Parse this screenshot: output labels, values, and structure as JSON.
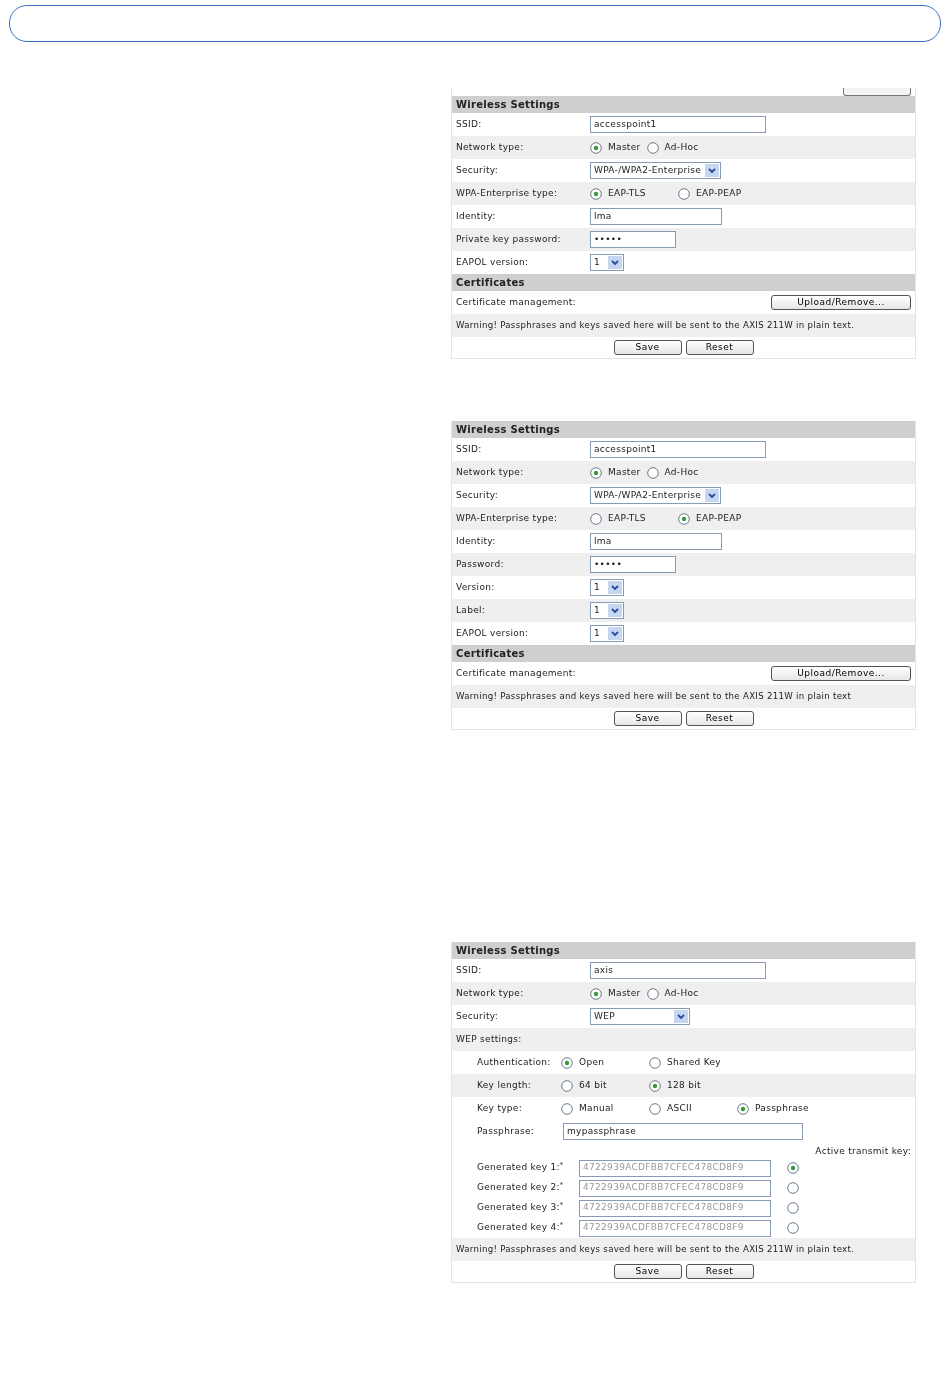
{
  "panels": [
    {
      "rows": [
        {
          "kind": "clipped_button"
        },
        {
          "kind": "section",
          "title": "Wireless Settings"
        },
        {
          "kind": "text",
          "label": "SSID:",
          "value": "accesspoint1"
        },
        {
          "kind": "radio",
          "label": "Network type:",
          "options": [
            {
              "label": "Master",
              "selected": true
            },
            {
              "label": "Ad-Hoc",
              "selected": false
            }
          ]
        },
        {
          "kind": "select",
          "label": "Security:",
          "value": "WPA-/WPA2-Enterprise"
        },
        {
          "kind": "radio_grid",
          "label": "WPA-Enterprise type:",
          "options": [
            {
              "label": "EAP-TLS",
              "selected": true
            },
            {
              "label": "EAP-PEAP",
              "selected": false
            }
          ]
        },
        {
          "kind": "short_text",
          "label": "Identity:",
          "value": "lma"
        },
        {
          "kind": "password",
          "label": "Private key password:",
          "value": "•••••"
        },
        {
          "kind": "short_select",
          "label": "EAPOL version:",
          "value": "1"
        },
        {
          "kind": "section",
          "title": "Certificates"
        },
        {
          "kind": "action",
          "label": "Certificate management:",
          "button": "Upload/Remove..."
        },
        {
          "kind": "note",
          "text": "Warning! Passphrases and keys saved here will be sent to the AXIS 211W in plain text."
        },
        {
          "kind": "buttons",
          "buttons": [
            "Save",
            "Reset"
          ]
        }
      ]
    },
    {
      "rows": [
        {
          "kind": "section",
          "title": "Wireless Settings"
        },
        {
          "kind": "text",
          "label": "SSID:",
          "value": "accesspoint1"
        },
        {
          "kind": "radio",
          "label": "Network type:",
          "options": [
            {
              "label": "Master",
              "selected": true
            },
            {
              "label": "Ad-Hoc",
              "selected": false
            }
          ]
        },
        {
          "kind": "select",
          "label": "Security:",
          "value": "WPA-/WPA2-Enterprise"
        },
        {
          "kind": "radio_grid",
          "label": "WPA-Enterprise type:",
          "options": [
            {
              "label": "EAP-TLS",
              "selected": false
            },
            {
              "label": "EAP-PEAP",
              "selected": true
            }
          ]
        },
        {
          "kind": "short_text",
          "label": "Identity:",
          "value": "lma"
        },
        {
          "kind": "password",
          "label": "Password:",
          "value": "•••••"
        },
        {
          "kind": "short_select",
          "label": "Version:",
          "value": "1"
        },
        {
          "kind": "short_select",
          "label": "Label:",
          "value": "1"
        },
        {
          "kind": "short_select",
          "label": "EAPOL version:",
          "value": "1"
        },
        {
          "kind": "section",
          "title": "Certificates"
        },
        {
          "kind": "action",
          "label": "Certificate management:",
          "button": "Upload/Remove..."
        },
        {
          "kind": "note",
          "text": "Warning! Passphrases and keys saved here will be sent to the AXIS 211W in plain text"
        },
        {
          "kind": "buttons",
          "buttons": [
            "Save",
            "Reset"
          ]
        }
      ]
    },
    {
      "rows": [
        {
          "kind": "section",
          "title": "Wireless Settings"
        },
        {
          "kind": "text",
          "label": "SSID:",
          "value": "axis"
        },
        {
          "kind": "radio",
          "label": "Network type:",
          "options": [
            {
              "label": "Master",
              "selected": true
            },
            {
              "label": "Ad-Hoc",
              "selected": false
            }
          ]
        },
        {
          "kind": "select",
          "label": "Security:",
          "value": "WEP"
        },
        {
          "kind": "group",
          "label": "WEP settings:",
          "children": [
            {
              "kind": "radio_grid",
              "label": "Authentication:",
              "options": [
                {
                  "label": "Open",
                  "selected": true
                },
                {
                  "label": "Shared Key",
                  "selected": false
                }
              ]
            },
            {
              "kind": "radio_grid",
              "label": "Key length:",
              "options": [
                {
                  "label": "64 bit",
                  "selected": false
                },
                {
                  "label": "128 bit",
                  "selected": true
                }
              ]
            },
            {
              "kind": "radio_grid",
              "label": "Key type:",
              "options": [
                {
                  "label": "Manual",
                  "selected": false
                },
                {
                  "label": "ASCII",
                  "selected": false
                },
                {
                  "label": "Passphrase",
                  "selected": true
                }
              ]
            },
            {
              "kind": "inline_text",
              "label": "Passphrase:",
              "value": "mypassphrase"
            },
            {
              "kind": "caption",
              "text": "Active transmit key:"
            },
            {
              "kind": "key",
              "label": "Generated key 1:$^{*}$",
              "value": "4722939ACDFBB7CFEC478CD8F9",
              "disabled": true,
              "selected": true
            },
            {
              "kind": "key",
              "label": "Generated key 2:$^{*}$",
              "value": "4722939ACDFBB7CFEC478CD8F9",
              "disabled": true,
              "selected": false
            },
            {
              "kind": "key",
              "label": "Generated key 3:$^{*}$",
              "value": "4722939ACDFBB7CFEC478CD8F9",
              "disabled": true,
              "selected": false
            },
            {
              "kind": "key",
              "label": "Generated key 4:$^{*}$",
              "value": "4722939ACDFBB7CFEC478CD8F9",
              "disabled": true,
              "selected": false
            }
          ]
        },
        {
          "kind": "note",
          "text": "Warning! Passphrases and keys saved here will be sent to the AXIS 211W in plain text."
        },
        {
          "kind": "buttons",
          "buttons": [
            "Save",
            "Reset"
          ]
        }
      ]
    }
  ]
}
